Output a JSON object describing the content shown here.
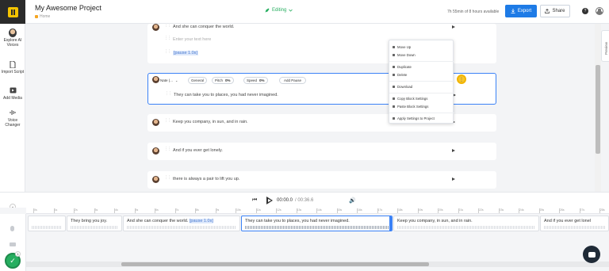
{
  "header": {
    "project_title": "My Awesome Project",
    "breadcrumb": "Home",
    "mode": "Editing",
    "time_remaining": "7h 55min of 8 hours available",
    "export_label": "Export",
    "share_label": "Share"
  },
  "sidebar": {
    "items": [
      {
        "label": "Explore AI Voices",
        "icon": "ai-voices-avatar-icon"
      },
      {
        "label": "Import Script",
        "icon": "document-icon"
      },
      {
        "label": "Add Media",
        "icon": "media-icon"
      },
      {
        "label": "Voice Changer",
        "icon": "voice-changer-icon"
      }
    ]
  },
  "editor": {
    "blocks": [
      {
        "lines": [
          "And she can conquer the world."
        ]
      },
      {
        "placeholder": "Enter your text here"
      },
      {
        "pause": "[pause 1.0s]"
      },
      {
        "voice": "Nate (...",
        "style": "General",
        "pitch_label": "Pitch",
        "pitch_value": "0%",
        "speed_label": "Speed",
        "speed_value": "0%",
        "add_pause": "Add Pause",
        "text": "They can take you to places, you had never imagined."
      },
      {
        "text": "Keep you company, in sun, and in rain."
      },
      {
        "text": "And if you ever get lonely."
      },
      {
        "text": "there is always a pair to lift you up."
      }
    ],
    "menu": [
      "Move Up",
      "Move Down",
      "Duplicate",
      "Delete",
      "Download",
      "Copy Block Settings",
      "Paste Block Settings",
      "Apply Settings to Project"
    ]
  },
  "preview_tab": "Preview",
  "player": {
    "current_time": "00:00.0",
    "total_time": "/ 00:36.6"
  },
  "timeline": {
    "ruler": [
      "0s",
      "1s",
      "2s",
      "3s",
      "4s",
      "5s",
      "6s",
      "7s",
      "8s",
      "9s",
      "10s",
      "11s",
      "12s",
      "13s",
      "14s",
      "15s",
      "16s",
      "17s",
      "18s",
      "19s",
      "20s",
      "21s",
      "22s",
      "23s",
      "24s",
      "25s",
      "26s",
      "27s",
      "28s"
    ],
    "clips": [
      {
        "text": ""
      },
      {
        "text": "They bring you joy."
      },
      {
        "text": "And she can conquer the world.",
        "pause": "[pause 1.0s]"
      },
      {
        "text": "They can take you to places, you had never imagined."
      },
      {
        "text": "Keep you company, in sun, and in rain."
      },
      {
        "text": "And if you ever get lonel"
      }
    ]
  },
  "notifications_count": "1"
}
